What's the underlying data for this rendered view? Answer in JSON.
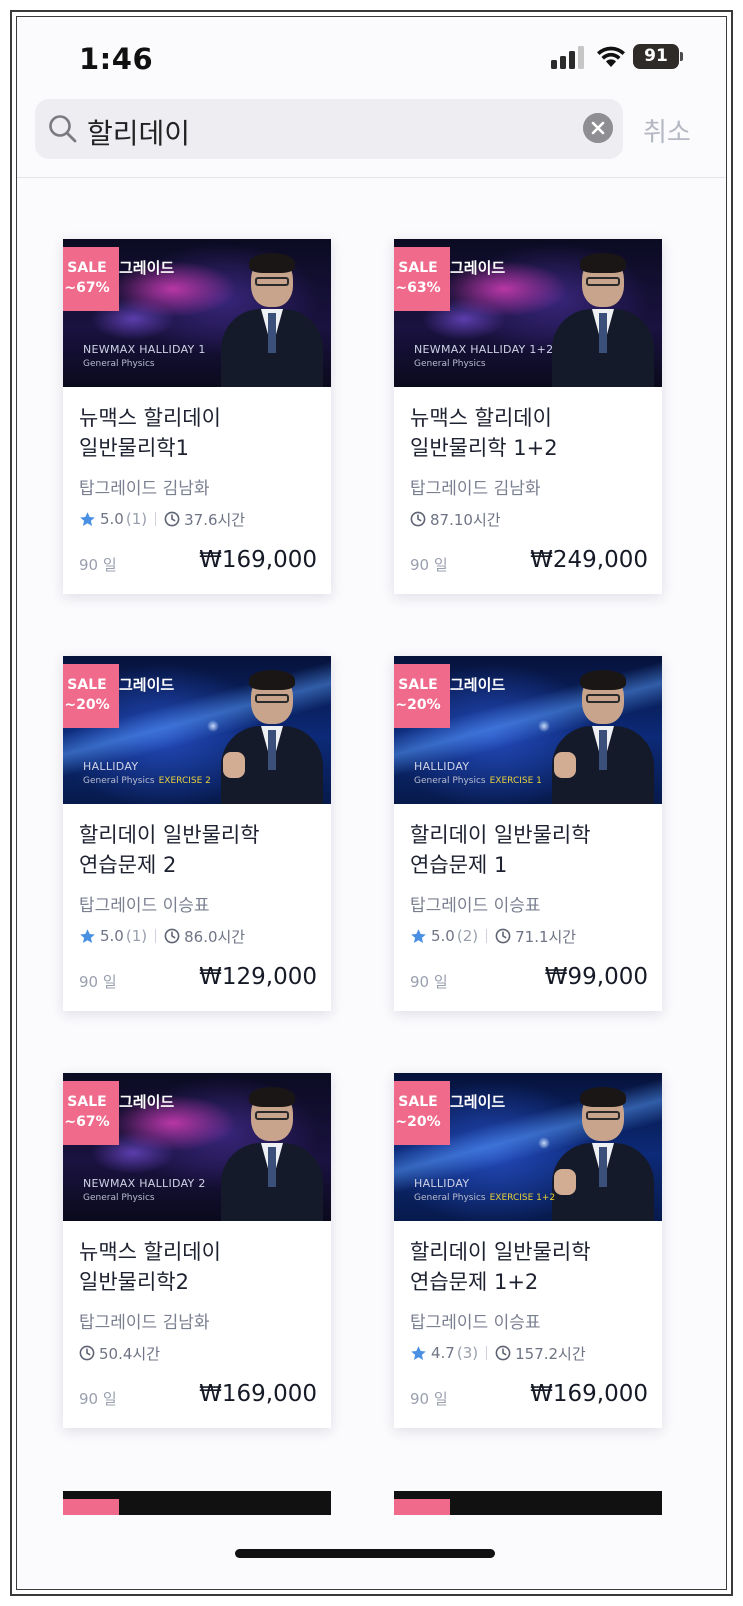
{
  "status_bar": {
    "time": "1:46",
    "battery": "91"
  },
  "search": {
    "query": "할리데이",
    "cancel_label": "취소"
  },
  "colors": {
    "sale_tag": "#f06a8c",
    "star": "#4a90e2",
    "accent_text": "#1e2230"
  },
  "courses": [
    {
      "sale": "SALE",
      "discount": "~67%",
      "brand": "그레이드",
      "thumb_title": "NEWMAX HALLIDAY 1",
      "thumb_sub": "General Physics",
      "thumb_exercise": "",
      "title_line1": "뉴맥스 할리데이",
      "title_line2": "일반물리학1",
      "instructor": "탑그레이드 김남화",
      "rating": "5.0",
      "rating_count": "(1)",
      "duration": "37.6시간",
      "days": "90 일",
      "price": "₩169,000"
    },
    {
      "sale": "SALE",
      "discount": "~63%",
      "brand": "그레이드",
      "thumb_title": "NEWMAX HALLIDAY 1+2",
      "thumb_sub": "General Physics",
      "thumb_exercise": "",
      "title_line1": "뉴맥스 할리데이",
      "title_line2": "일반물리학 1+2",
      "instructor": "탑그레이드 김남화",
      "rating": "",
      "rating_count": "",
      "duration": "87.10시간",
      "days": "90 일",
      "price": "₩249,000"
    },
    {
      "sale": "SALE",
      "discount": "~20%",
      "brand": "그레이드",
      "thumb_title": "HALLIDAY",
      "thumb_sub": "General Physics",
      "thumb_exercise": "EXERCISE 2",
      "title_line1": "할리데이 일반물리학",
      "title_line2": "연습문제 2",
      "instructor": "탑그레이드 이승표",
      "rating": "5.0",
      "rating_count": "(1)",
      "duration": "86.0시간",
      "days": "90 일",
      "price": "₩129,000"
    },
    {
      "sale": "SALE",
      "discount": "~20%",
      "brand": "그레이드",
      "thumb_title": "HALLIDAY",
      "thumb_sub": "General Physics",
      "thumb_exercise": "EXERCISE 1",
      "title_line1": "할리데이 일반물리학",
      "title_line2": "연습문제 1",
      "instructor": "탑그레이드 이승표",
      "rating": "5.0",
      "rating_count": "(2)",
      "duration": "71.1시간",
      "days": "90 일",
      "price": "₩99,000"
    },
    {
      "sale": "SALE",
      "discount": "~67%",
      "brand": "그레이드",
      "thumb_title": "NEWMAX HALLIDAY 2",
      "thumb_sub": "General Physics",
      "thumb_exercise": "",
      "title_line1": "뉴맥스 할리데이",
      "title_line2": "일반물리학2",
      "instructor": "탑그레이드 김남화",
      "rating": "",
      "rating_count": "",
      "duration": "50.4시간",
      "days": "90 일",
      "price": "₩169,000"
    },
    {
      "sale": "SALE",
      "discount": "~20%",
      "brand": "그레이드",
      "thumb_title": "HALLIDAY",
      "thumb_sub": "General Physics",
      "thumb_exercise": "EXERCISE 1+2",
      "title_line1": "할리데이 일반물리학",
      "title_line2": "연습문제 1+2",
      "instructor": "탑그레이드 이승표",
      "rating": "4.7",
      "rating_count": "(3)",
      "duration": "157.2시간",
      "days": "90 일",
      "price": "₩169,000"
    }
  ]
}
